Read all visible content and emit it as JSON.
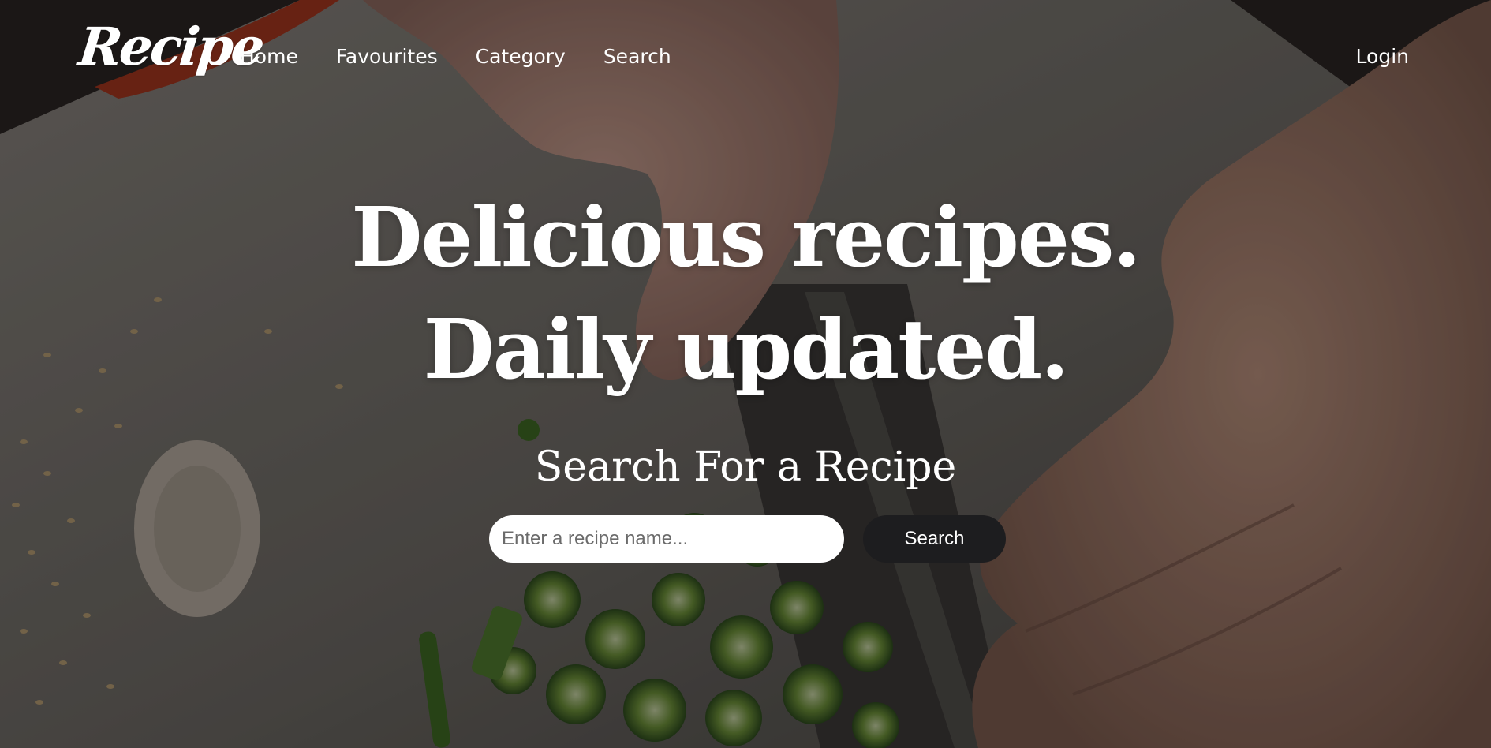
{
  "brand": {
    "logo_text": "Recipe"
  },
  "nav": {
    "items": [
      {
        "label": "Home"
      },
      {
        "label": "Favourites"
      },
      {
        "label": "Category"
      },
      {
        "label": "Search"
      }
    ],
    "login_label": "Login"
  },
  "hero": {
    "headline_line1": "Delicious recipes.",
    "headline_line2": "Daily updated.",
    "background_icon": "food-prep-photo"
  },
  "search": {
    "title": "Search For a Recipe",
    "placeholder": "Enter a recipe name...",
    "value": "",
    "button_label": "Search"
  },
  "colors": {
    "text": "#ffffff",
    "button_bg": "#1d1d1f",
    "input_bg": "#ffffff"
  }
}
